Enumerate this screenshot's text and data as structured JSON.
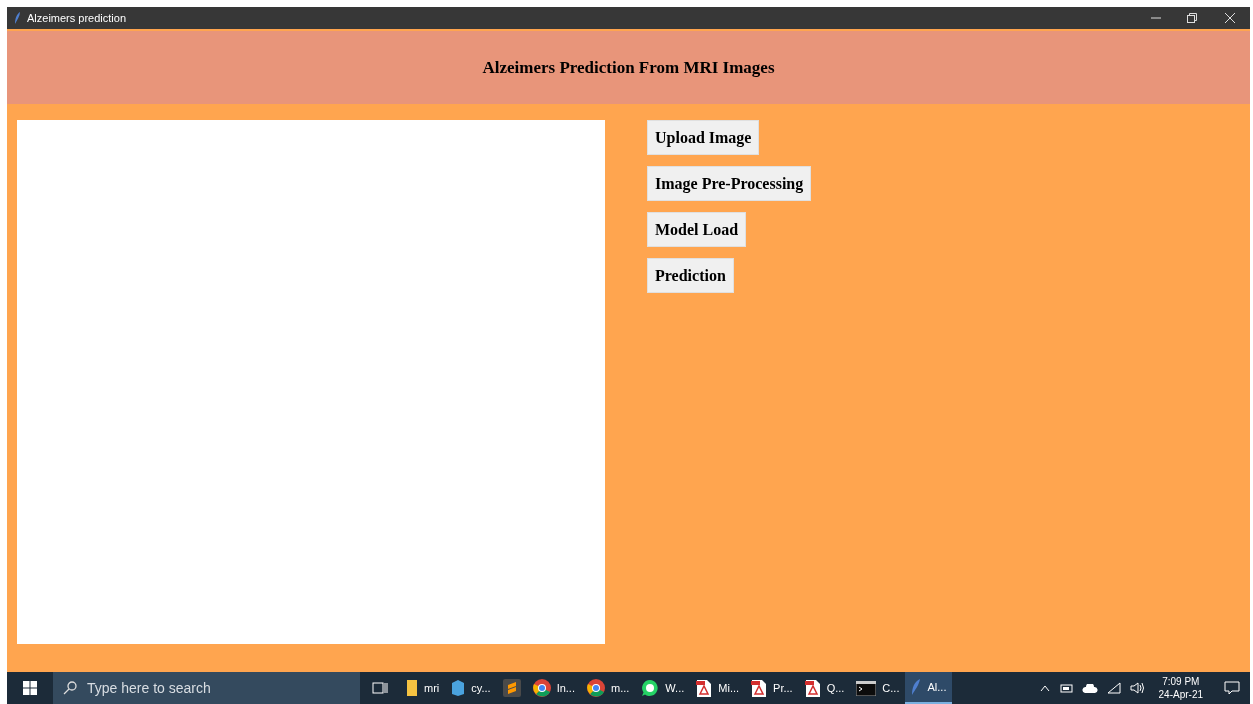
{
  "window": {
    "title": "Alzeimers prediction"
  },
  "header": {
    "title": "Alzeimers Prediction From MRI Images"
  },
  "buttons": [
    "Upload Image",
    "Image Pre-Processing",
    "Model Load",
    "Prediction"
  ],
  "taskbar": {
    "search": {
      "placeholder": "Type here to search"
    },
    "apps": [
      {
        "kind": "folder",
        "label": "mri",
        "selected": false
      },
      {
        "kind": "cube",
        "label": "cy...",
        "selected": false
      },
      {
        "kind": "editor",
        "selected": false
      },
      {
        "kind": "browser",
        "label": "In...",
        "selected": false
      },
      {
        "kind": "browser",
        "label": "m...",
        "selected": false
      },
      {
        "kind": "chat",
        "label": "W...",
        "selected": false
      },
      {
        "kind": "pdf",
        "label": "Mi...",
        "selected": false
      },
      {
        "kind": "pdf",
        "label": "Pr...",
        "selected": false
      },
      {
        "kind": "pdf",
        "label": "Q...",
        "selected": false
      },
      {
        "kind": "terminal",
        "label": "C...",
        "selected": false
      },
      {
        "kind": "feather",
        "label": "Al...",
        "selected": true
      }
    ],
    "time": "7:09 PM",
    "date": "24-Apr-21"
  }
}
